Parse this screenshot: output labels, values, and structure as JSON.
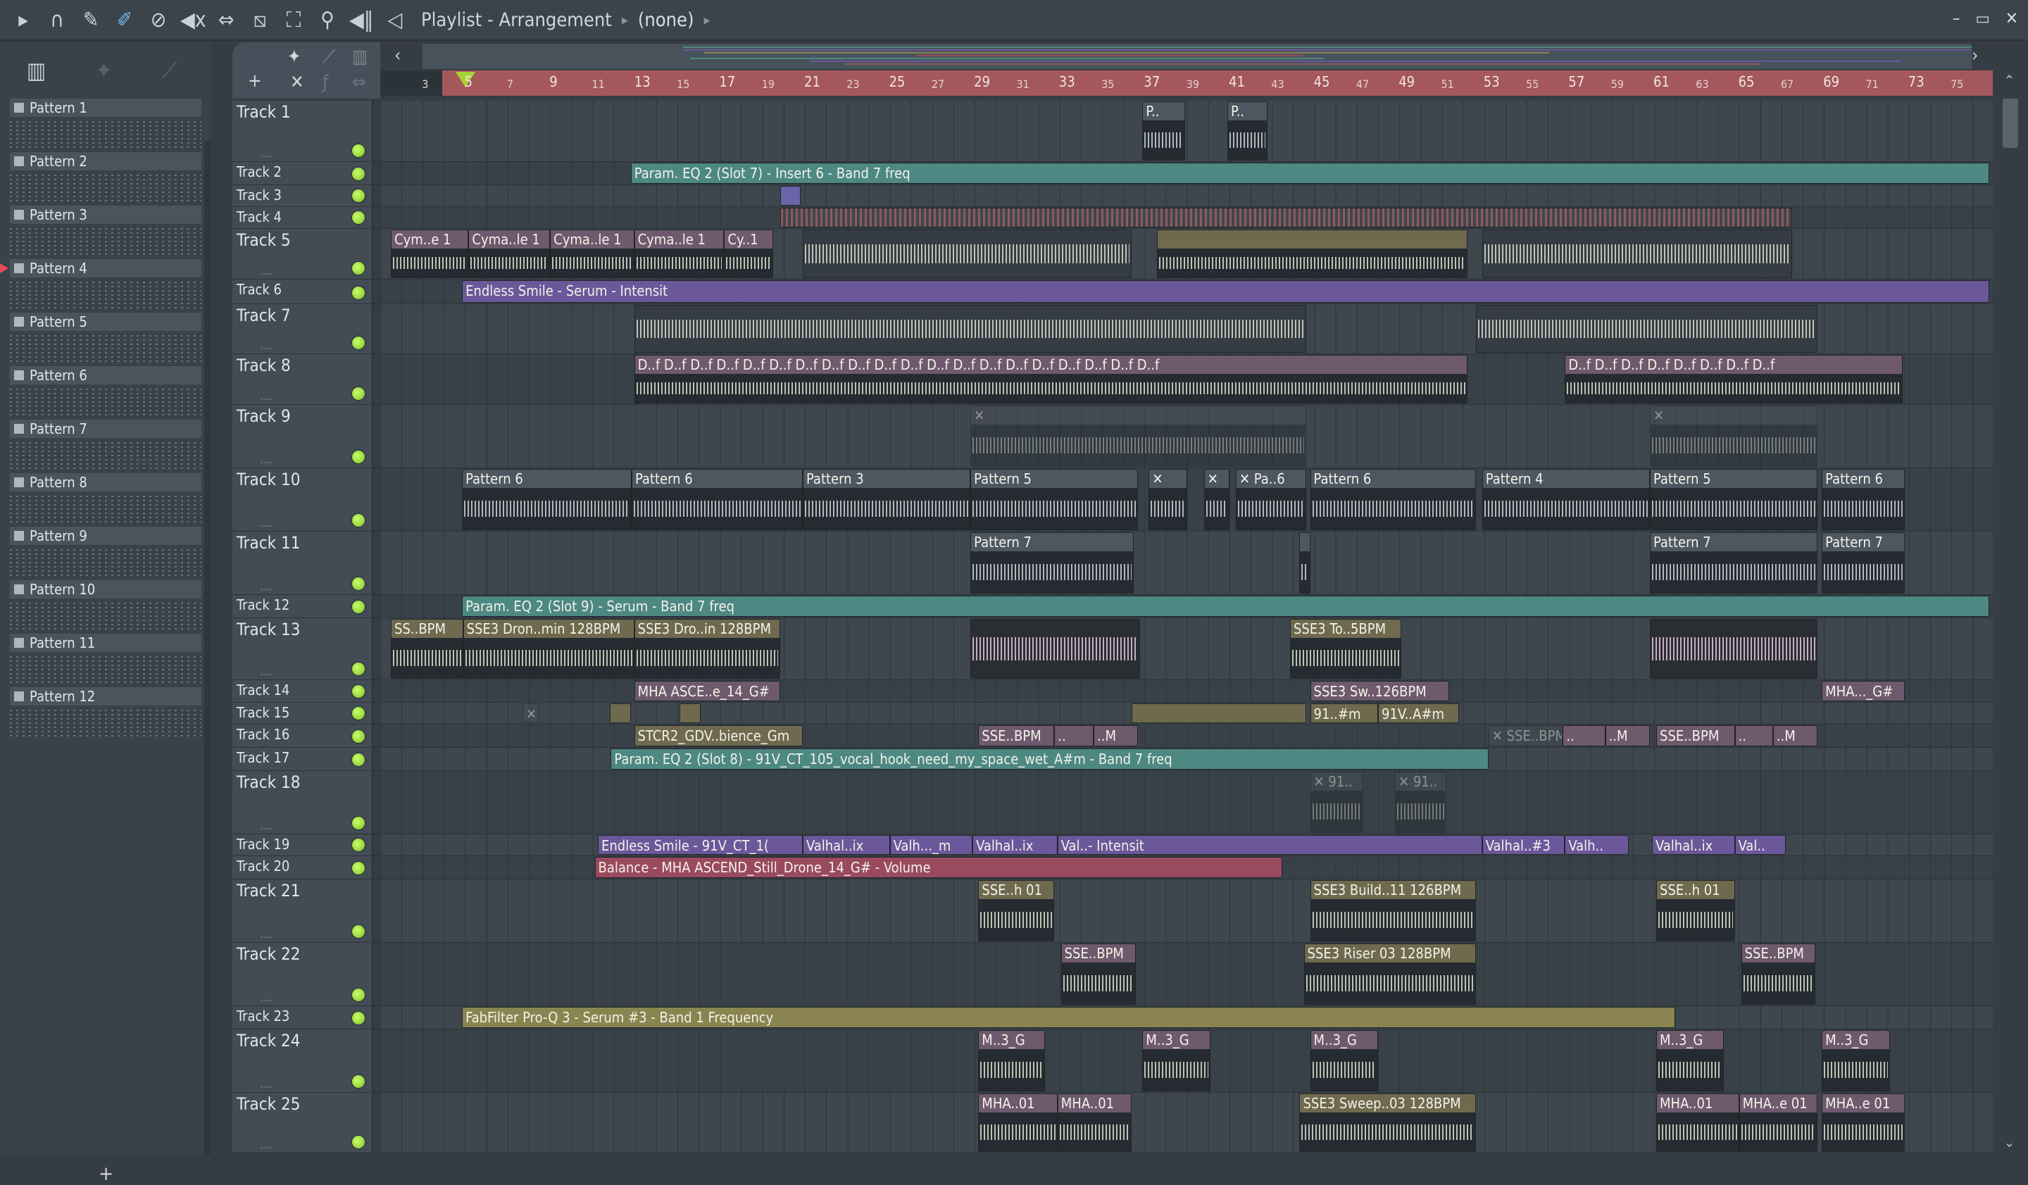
{
  "toolbar": {
    "icons": [
      "play-arrow",
      "magnet",
      "pencil",
      "paint",
      "delete",
      "mute",
      "slip",
      "slice",
      "select",
      "zoom",
      "playback"
    ],
    "title": "Playlist - Arrangement",
    "context": "(none)",
    "window_buttons": [
      "–",
      "▭",
      "✕"
    ]
  },
  "pattern_panel": {
    "patterns": [
      "Pattern 1",
      "Pattern 2",
      "Pattern 3",
      "Pattern 4",
      "Pattern 5",
      "Pattern 6",
      "Pattern 7",
      "Pattern 8",
      "Pattern 9",
      "Pattern 10",
      "Pattern 11",
      "Pattern 12"
    ],
    "selected": "Pattern 4",
    "add_label": "+"
  },
  "ruler": {
    "bars": [
      3,
      5,
      7,
      9,
      11,
      13,
      15,
      17,
      19,
      21,
      23,
      25,
      27,
      29,
      31,
      33,
      35,
      37,
      39,
      41,
      43,
      45,
      47,
      49,
      51,
      53,
      55,
      57,
      59,
      61,
      63,
      65,
      67,
      69,
      71,
      73,
      75
    ],
    "playhead_bar": 4
  },
  "tracks": [
    {
      "name": "Track 1",
      "clips": [
        {
          "label": "P..",
          "start": 36.8,
          "end": 38.8,
          "kind": "pattern",
          "color": "#4e5760"
        },
        {
          "label": "P..",
          "start": 40.8,
          "end": 42.7,
          "kind": "pattern",
          "color": "#4e5760"
        }
      ]
    },
    {
      "name": "Track 2",
      "clips": [
        {
          "label": "Param. EQ 2 (Slot 7) - Insert 6 - Band 7 freq",
          "start": 12.7,
          "end": 76.7,
          "kind": "auto",
          "color": "#4d8883"
        }
      ]
    },
    {
      "name": "Track 3",
      "clips": [
        {
          "label": "",
          "start": 19.75,
          "end": 20.7,
          "kind": "auto",
          "color": "#6a64a8"
        }
      ]
    },
    {
      "name": "Track 4",
      "clips": [
        {
          "label": "",
          "start": 19.75,
          "end": 67.4,
          "kind": "strip",
          "color": "#8d5a5e"
        }
      ]
    },
    {
      "name": "Track 5",
      "clips": [
        {
          "label": "Cym..e 1",
          "start": 1.4,
          "end": 5.06,
          "kind": "audio",
          "color": "#6e5a6c"
        },
        {
          "label": "Cyma..le 1",
          "start": 5.06,
          "end": 8.9,
          "kind": "audio",
          "color": "#6e5a6c"
        },
        {
          "label": "Cyma..le 1",
          "start": 8.9,
          "end": 12.86,
          "kind": "audio",
          "color": "#6e5a6c"
        },
        {
          "label": "Cyma..le 1",
          "start": 12.86,
          "end": 17.1,
          "kind": "audio",
          "color": "#6e5a6c"
        },
        {
          "label": "Cy..1",
          "start": 17.1,
          "end": 19.4,
          "kind": "audio",
          "color": "#6e5a6c"
        },
        {
          "label": "",
          "start": 20.8,
          "end": 36.3,
          "kind": "wave",
          "color": "#4a5158"
        },
        {
          "label": "",
          "start": 37.5,
          "end": 52.1,
          "kind": "audio",
          "color": "#6f6a4e"
        },
        {
          "label": "",
          "start": 52.8,
          "end": 67.4,
          "kind": "wave",
          "color": "#4a5158"
        }
      ]
    },
    {
      "name": "Track 6",
      "clips": [
        {
          "label": "Endless Smile - Serum - Intensit",
          "start": 4.75,
          "end": 76.7,
          "kind": "auto",
          "color": "#6a589a"
        }
      ]
    },
    {
      "name": "Track 7",
      "clips": [
        {
          "label": "",
          "start": 12.86,
          "end": 44.5,
          "kind": "wave",
          "color": "#4a5158"
        },
        {
          "label": "",
          "start": 52.5,
          "end": 68.6,
          "kind": "wave",
          "color": "#4a5158"
        }
      ]
    },
    {
      "name": "Track 8",
      "clips": [
        {
          "label": "D..f  D..f  D..f  D..f  D..f  D..f  D..f  D..f  D..f  D..f  D..f  D..f  D..f  D..f  D..f  D..f  D..f  D..f  D..f  D..f",
          "start": 12.86,
          "end": 52.1,
          "kind": "audio",
          "color": "#6e5a6c"
        },
        {
          "label": "D..f  D..f  D..f  D..f  D..f  D..f  D..f  D..f",
          "start": 56.7,
          "end": 72.6,
          "kind": "audio",
          "color": "#6e5a6c"
        }
      ]
    },
    {
      "name": "Track 9",
      "clips": [
        {
          "label": "✕",
          "start": 28.7,
          "end": 44.5,
          "kind": "audio",
          "color": "#4a5158"
        },
        {
          "label": "✕",
          "start": 60.7,
          "end": 68.6,
          "kind": "audio",
          "color": "#4a5158"
        }
      ]
    },
    {
      "name": "Track 10",
      "clips": [
        {
          "label": "Pattern 6",
          "start": 4.75,
          "end": 12.74,
          "kind": "pattern",
          "color": "#4e5760"
        },
        {
          "label": "Pattern 6",
          "start": 12.74,
          "end": 20.8,
          "kind": "pattern",
          "color": "#4e5760"
        },
        {
          "label": "Pattern 3",
          "start": 20.8,
          "end": 28.7,
          "kind": "pattern",
          "color": "#4e5760"
        },
        {
          "label": "Pattern 5",
          "start": 28.7,
          "end": 36.6,
          "kind": "pattern",
          "color": "#4e5760"
        },
        {
          "label": "✕",
          "start": 37.1,
          "end": 38.9,
          "kind": "pattern",
          "color": "#4e5760"
        },
        {
          "label": "✕",
          "start": 39.7,
          "end": 40.9,
          "kind": "pattern",
          "color": "#4e5760"
        },
        {
          "label": "✕ Pa..6",
          "start": 41.2,
          "end": 44.5,
          "kind": "pattern",
          "color": "#4e5760"
        },
        {
          "label": "Pattern 6",
          "start": 44.7,
          "end": 52.5,
          "kind": "pattern",
          "color": "#4e5760"
        },
        {
          "label": "Pattern 4",
          "start": 52.8,
          "end": 60.7,
          "kind": "pattern",
          "color": "#4e5760"
        },
        {
          "label": "Pattern 5",
          "start": 60.7,
          "end": 68.6,
          "kind": "pattern",
          "color": "#4e5760"
        },
        {
          "label": "Pattern 6",
          "start": 68.8,
          "end": 72.7,
          "kind": "pattern",
          "color": "#4e5760"
        }
      ]
    },
    {
      "name": "Track 11",
      "clips": [
        {
          "label": "Pattern 7",
          "start": 28.7,
          "end": 36.4,
          "kind": "pattern",
          "color": "#4e5760"
        },
        {
          "label": "",
          "start": 44.2,
          "end": 44.7,
          "kind": "pattern",
          "color": "#4e5760"
        },
        {
          "label": "Pattern 7",
          "start": 60.7,
          "end": 68.6,
          "kind": "pattern",
          "color": "#4e5760"
        },
        {
          "label": "Pattern 7",
          "start": 68.8,
          "end": 72.7,
          "kind": "pattern",
          "color": "#4e5760"
        }
      ]
    },
    {
      "name": "Track 12",
      "clips": [
        {
          "label": "Param. EQ 2 (Slot 9) - Serum - Band 7 freq",
          "start": 4.75,
          "end": 76.7,
          "kind": "auto",
          "color": "#4d8883"
        }
      ]
    },
    {
      "name": "Track 13",
      "clips": [
        {
          "label": "SS..BPM",
          "start": 1.4,
          "end": 4.8,
          "kind": "audio",
          "color": "#6f6a4e"
        },
        {
          "label": "SSE3 Dron..min 128BPM",
          "start": 4.8,
          "end": 12.86,
          "kind": "audio",
          "color": "#6f6a4e"
        },
        {
          "label": "SSE3 Dro..in 128BPM",
          "start": 12.86,
          "end": 19.75,
          "kind": "audio",
          "color": "#6f6a4e"
        },
        {
          "label": "",
          "start": 28.7,
          "end": 36.7,
          "kind": "pink",
          "color": "#6e5a6c"
        },
        {
          "label": "SSE3 To..5BPM",
          "start": 43.75,
          "end": 49.0,
          "kind": "audio",
          "color": "#6f6a4e"
        },
        {
          "label": "",
          "start": 60.7,
          "end": 68.6,
          "kind": "pink",
          "color": "#6e5a6c"
        }
      ]
    },
    {
      "name": "Track 14",
      "clips": [
        {
          "label": "MHA ASCE..e_14_G#",
          "start": 12.86,
          "end": 19.75,
          "kind": "auto",
          "color": "#6e5a6c"
        },
        {
          "label": "SSE3 Sw..126BPM",
          "start": 44.7,
          "end": 51.25,
          "kind": "auto",
          "color": "#6e5a6c"
        },
        {
          "label": "MHA..._G#",
          "start": 68.8,
          "end": 72.7,
          "kind": "auto",
          "color": "#6e5a6c"
        }
      ]
    },
    {
      "name": "Track 15",
      "clips": [
        {
          "label": "✕",
          "start": 7.6,
          "end": 8.4,
          "kind": "auto",
          "color": "#4a5158"
        },
        {
          "label": "",
          "start": 11.7,
          "end": 12.7,
          "kind": "auto",
          "color": "#6f6a4e"
        },
        {
          "label": "",
          "start": 15.0,
          "end": 16.0,
          "kind": "auto",
          "color": "#6f6a4e"
        },
        {
          "label": "",
          "start": 36.3,
          "end": 44.5,
          "kind": "auto",
          "color": "#6f6a4e"
        },
        {
          "label": "91..#m",
          "start": 44.7,
          "end": 47.9,
          "kind": "auto",
          "color": "#6f6a4e"
        },
        {
          "label": "91V..A#m",
          "start": 47.9,
          "end": 51.7,
          "kind": "auto",
          "color": "#6f6a4e"
        }
      ]
    },
    {
      "name": "Track 16",
      "clips": [
        {
          "label": "STCR2_GDV..bience_Gm",
          "start": 12.86,
          "end": 20.8,
          "kind": "auto",
          "color": "#6f6a4e"
        },
        {
          "label": "SSE..BPM",
          "start": 29.07,
          "end": 32.65,
          "kind": "auto",
          "color": "#6e5a6c"
        },
        {
          "label": "..",
          "start": 32.65,
          "end": 34.5,
          "kind": "auto",
          "color": "#6e5a6c"
        },
        {
          "label": "..M",
          "start": 34.5,
          "end": 36.6,
          "kind": "auto",
          "color": "#6e5a6c"
        },
        {
          "label": "✕ SSE..BPM",
          "start": 53.1,
          "end": 56.6,
          "kind": "auto",
          "color": "#4a5158"
        },
        {
          "label": "..",
          "start": 56.6,
          "end": 58.6,
          "kind": "auto",
          "color": "#6e5a6c"
        },
        {
          "label": "..M",
          "start": 58.6,
          "end": 60.7,
          "kind": "auto",
          "color": "#6e5a6c"
        },
        {
          "label": "SSE..BPM",
          "start": 61.0,
          "end": 64.7,
          "kind": "auto",
          "color": "#6e5a6c"
        },
        {
          "label": "..",
          "start": 64.7,
          "end": 66.5,
          "kind": "auto",
          "color": "#6e5a6c"
        },
        {
          "label": "..M",
          "start": 66.5,
          "end": 68.6,
          "kind": "auto",
          "color": "#6e5a6c"
        }
      ]
    },
    {
      "name": "Track 17",
      "clips": [
        {
          "label": "Param. EQ 2 (Slot 8) - 91V_CT_105_vocal_hook_need_my_space_wet_A#m - Band 7 freq",
          "start": 11.76,
          "end": 53.1,
          "kind": "auto",
          "color": "#4d8883"
        }
      ]
    },
    {
      "name": "Track 18",
      "clips": [
        {
          "label": "✕ 91..",
          "start": 44.7,
          "end": 47.2,
          "kind": "audio",
          "color": "#4a5158"
        },
        {
          "label": "✕ 91..",
          "start": 48.7,
          "end": 51.1,
          "kind": "audio",
          "color": "#4a5158"
        }
      ]
    },
    {
      "name": "Track 19",
      "clips": [
        {
          "label": "Endless Smile - 91V_CT_1(",
          "start": 11.15,
          "end": 20.8,
          "kind": "auto",
          "color": "#6a589a"
        },
        {
          "label": "Valhal..ix",
          "start": 20.8,
          "end": 24.9,
          "kind": "auto",
          "color": "#6a589a"
        },
        {
          "label": "Valh..._m",
          "start": 24.9,
          "end": 28.8,
          "kind": "auto",
          "color": "#6a589a"
        },
        {
          "label": "Valhal..ix",
          "start": 28.8,
          "end": 32.8,
          "kind": "auto",
          "color": "#6a589a"
        },
        {
          "label": "Val..- Intensit",
          "start": 32.8,
          "end": 52.8,
          "kind": "auto",
          "color": "#6a589a"
        },
        {
          "label": "Valhal..#3",
          "start": 52.8,
          "end": 56.7,
          "kind": "auto",
          "color": "#6a589a"
        },
        {
          "label": "Valh..",
          "start": 56.7,
          "end": 59.7,
          "kind": "auto",
          "color": "#6a589a"
        },
        {
          "label": "Valhal..ix",
          "start": 60.8,
          "end": 64.7,
          "kind": "auto",
          "color": "#6a589a"
        },
        {
          "label": "Val..",
          "start": 64.7,
          "end": 67.1,
          "kind": "auto",
          "color": "#6a589a"
        }
      ]
    },
    {
      "name": "Track 20",
      "clips": [
        {
          "label": "Balance - MHA ASCEND_Still_Drone_14_G# - Volume",
          "start": 11.0,
          "end": 43.4,
          "kind": "auto",
          "color": "#9a4a5e"
        }
      ]
    },
    {
      "name": "Track 21",
      "clips": [
        {
          "label": "SSE..h 01",
          "start": 29.07,
          "end": 32.65,
          "kind": "audio",
          "color": "#6f6a4e"
        },
        {
          "label": "SSE3 Build..11 126BPM",
          "start": 44.7,
          "end": 52.5,
          "kind": "audio",
          "color": "#6f6a4e"
        },
        {
          "label": "SSE..h 01",
          "start": 61.0,
          "end": 64.7,
          "kind": "audio",
          "color": "#6f6a4e"
        }
      ]
    },
    {
      "name": "Track 22",
      "clips": [
        {
          "label": "SSE..BPM",
          "start": 32.96,
          "end": 36.5,
          "kind": "audio",
          "color": "#6e5a6c"
        },
        {
          "label": "SSE3 Riser 03 128BPM",
          "start": 44.4,
          "end": 52.5,
          "kind": "audio",
          "color": "#6f6a4e"
        },
        {
          "label": "SSE..BPM",
          "start": 65.0,
          "end": 68.5,
          "kind": "audio",
          "color": "#6e5a6c"
        }
      ]
    },
    {
      "name": "Track 23",
      "clips": [
        {
          "label": "FabFilter Pro-Q 3 - Serum #3 - Band 1 Frequency",
          "start": 4.75,
          "end": 61.9,
          "kind": "auto",
          "color": "#8a8450"
        }
      ]
    },
    {
      "name": "Track 24",
      "clips": [
        {
          "label": "M..3_G",
          "start": 29.07,
          "end": 32.2,
          "kind": "audio",
          "color": "#6e5a6c"
        },
        {
          "label": "M..3_G",
          "start": 36.8,
          "end": 40.0,
          "kind": "audio",
          "color": "#6e5a6c"
        },
        {
          "label": "M..3_G",
          "start": 44.7,
          "end": 47.9,
          "kind": "audio",
          "color": "#6e5a6c"
        },
        {
          "label": "M..3_G",
          "start": 61.0,
          "end": 64.2,
          "kind": "audio",
          "color": "#6e5a6c"
        },
        {
          "label": "M..3_G",
          "start": 68.8,
          "end": 72.0,
          "kind": "audio",
          "color": "#6e5a6c"
        }
      ]
    },
    {
      "name": "Track 25",
      "clips": [
        {
          "label": "MHA..01",
          "start": 29.07,
          "end": 32.8,
          "kind": "audio",
          "color": "#6e5a6c"
        },
        {
          "label": "MHA..01",
          "start": 32.8,
          "end": 36.3,
          "kind": "audio",
          "color": "#6e5a6c"
        },
        {
          "label": "SSE3 Sweep..03 128BPM",
          "start": 44.2,
          "end": 52.5,
          "kind": "audio",
          "color": "#6f6a4e"
        },
        {
          "label": "MHA..01",
          "start": 61.0,
          "end": 64.9,
          "kind": "audio",
          "color": "#6e5a6c"
        },
        {
          "label": "MHA..e 01",
          "start": 64.9,
          "end": 68.6,
          "kind": "audio",
          "color": "#6e5a6c"
        },
        {
          "label": "MHA..e 01",
          "start": 68.8,
          "end": 72.7,
          "kind": "audio",
          "color": "#6e5a6c"
        }
      ]
    }
  ]
}
